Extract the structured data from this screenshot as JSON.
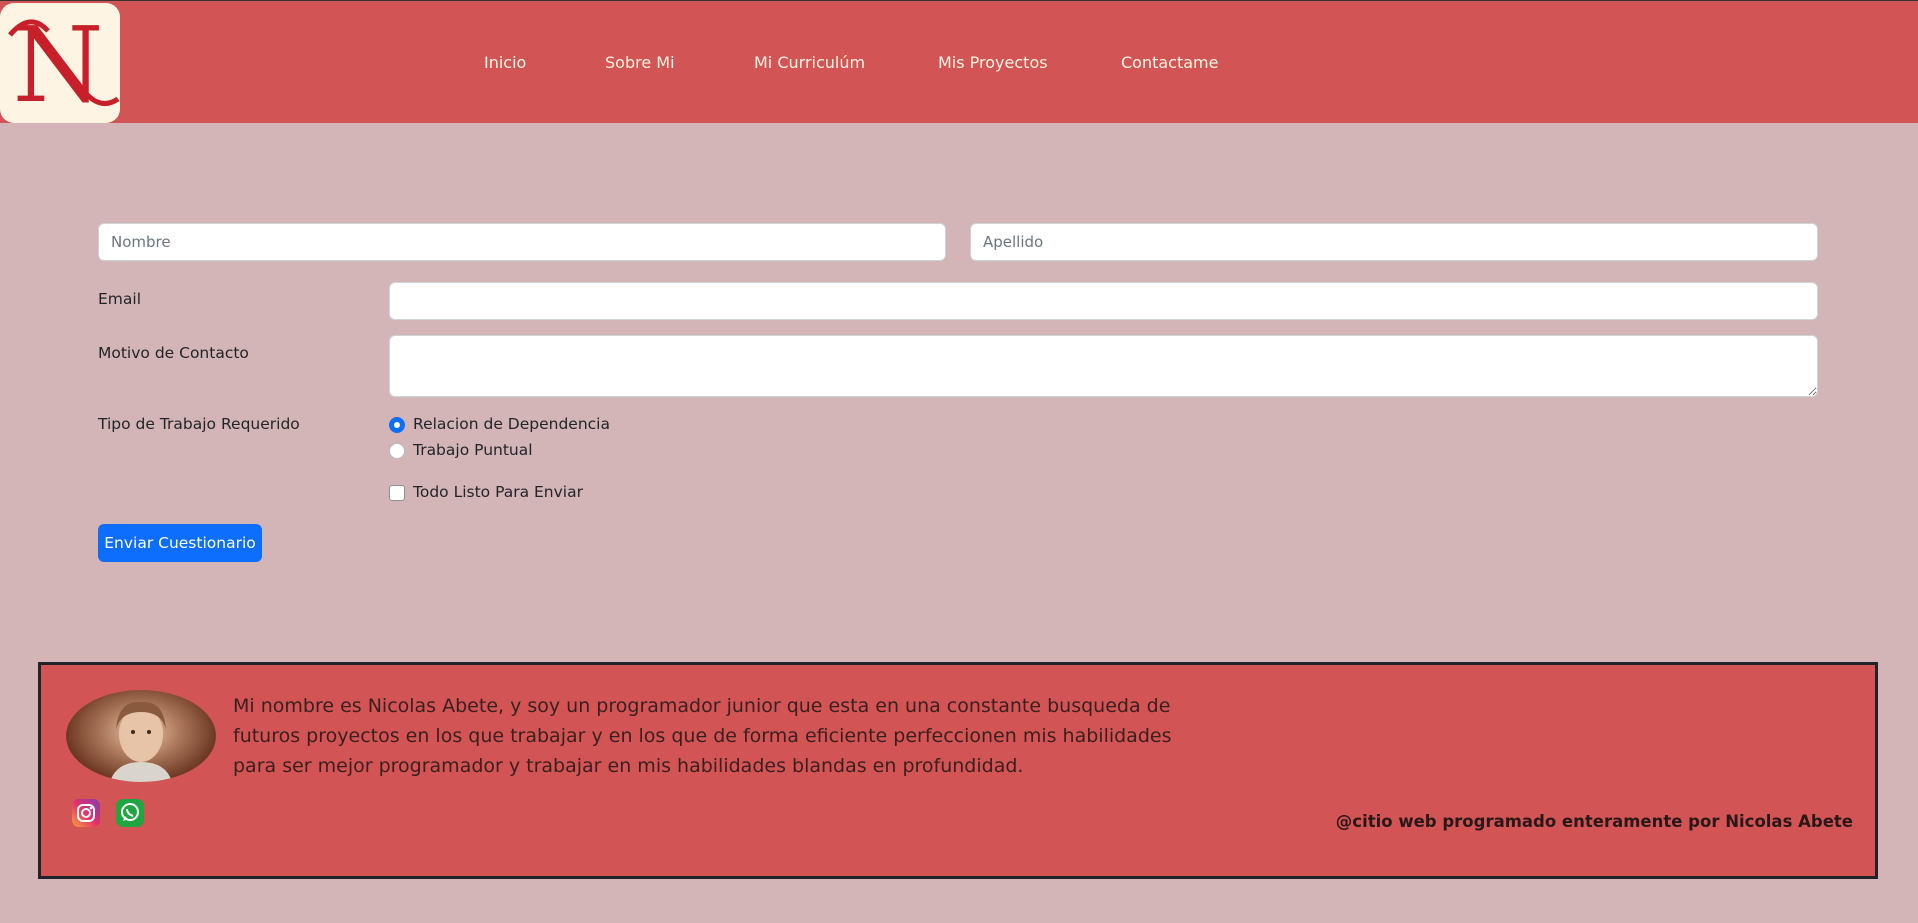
{
  "brand": {
    "logo_letter": "N"
  },
  "nav": {
    "items": [
      {
        "label": "Inicio"
      },
      {
        "label": "Sobre Mi"
      },
      {
        "label": "Mi Curriculúm"
      },
      {
        "label": "Mis Proyectos"
      },
      {
        "label": "Contactame"
      }
    ]
  },
  "form": {
    "nombre_placeholder": "Nombre",
    "apellido_placeholder": "Apellido",
    "email_label": "Email",
    "email_value": "",
    "motivo_label": "Motivo de Contacto",
    "motivo_value": "",
    "tipo_label": "Tipo de Trabajo Requerido",
    "radio_options": [
      {
        "label": "Relacion de Dependencia",
        "checked": true
      },
      {
        "label": "Trabajo Puntual",
        "checked": false
      }
    ],
    "checkbox_label": "Todo Listo Para Enviar",
    "checkbox_checked": false,
    "submit_label": "Enviar Cuestionario"
  },
  "footer": {
    "bio": "Mi nombre es Nicolas Abete, y soy un programador junior que esta en una constante busqueda de futuros proyectos en los que trabajar y en los que de forma eficiente perfeccionen mis habilidades para ser mejor programador y trabajar en mis habilidades blandas en profundidad.",
    "social": [
      {
        "icon": "instagram-icon"
      },
      {
        "icon": "whatsapp-icon"
      }
    ],
    "credit": "@citio web programado enteramente por Nicolas Abete"
  },
  "colors": {
    "navbar": "#d35455",
    "background": "#d4b5b7",
    "primary": "#0d6efd",
    "logo_bg": "#fdf4e3",
    "logo_letter": "#c8202a"
  }
}
